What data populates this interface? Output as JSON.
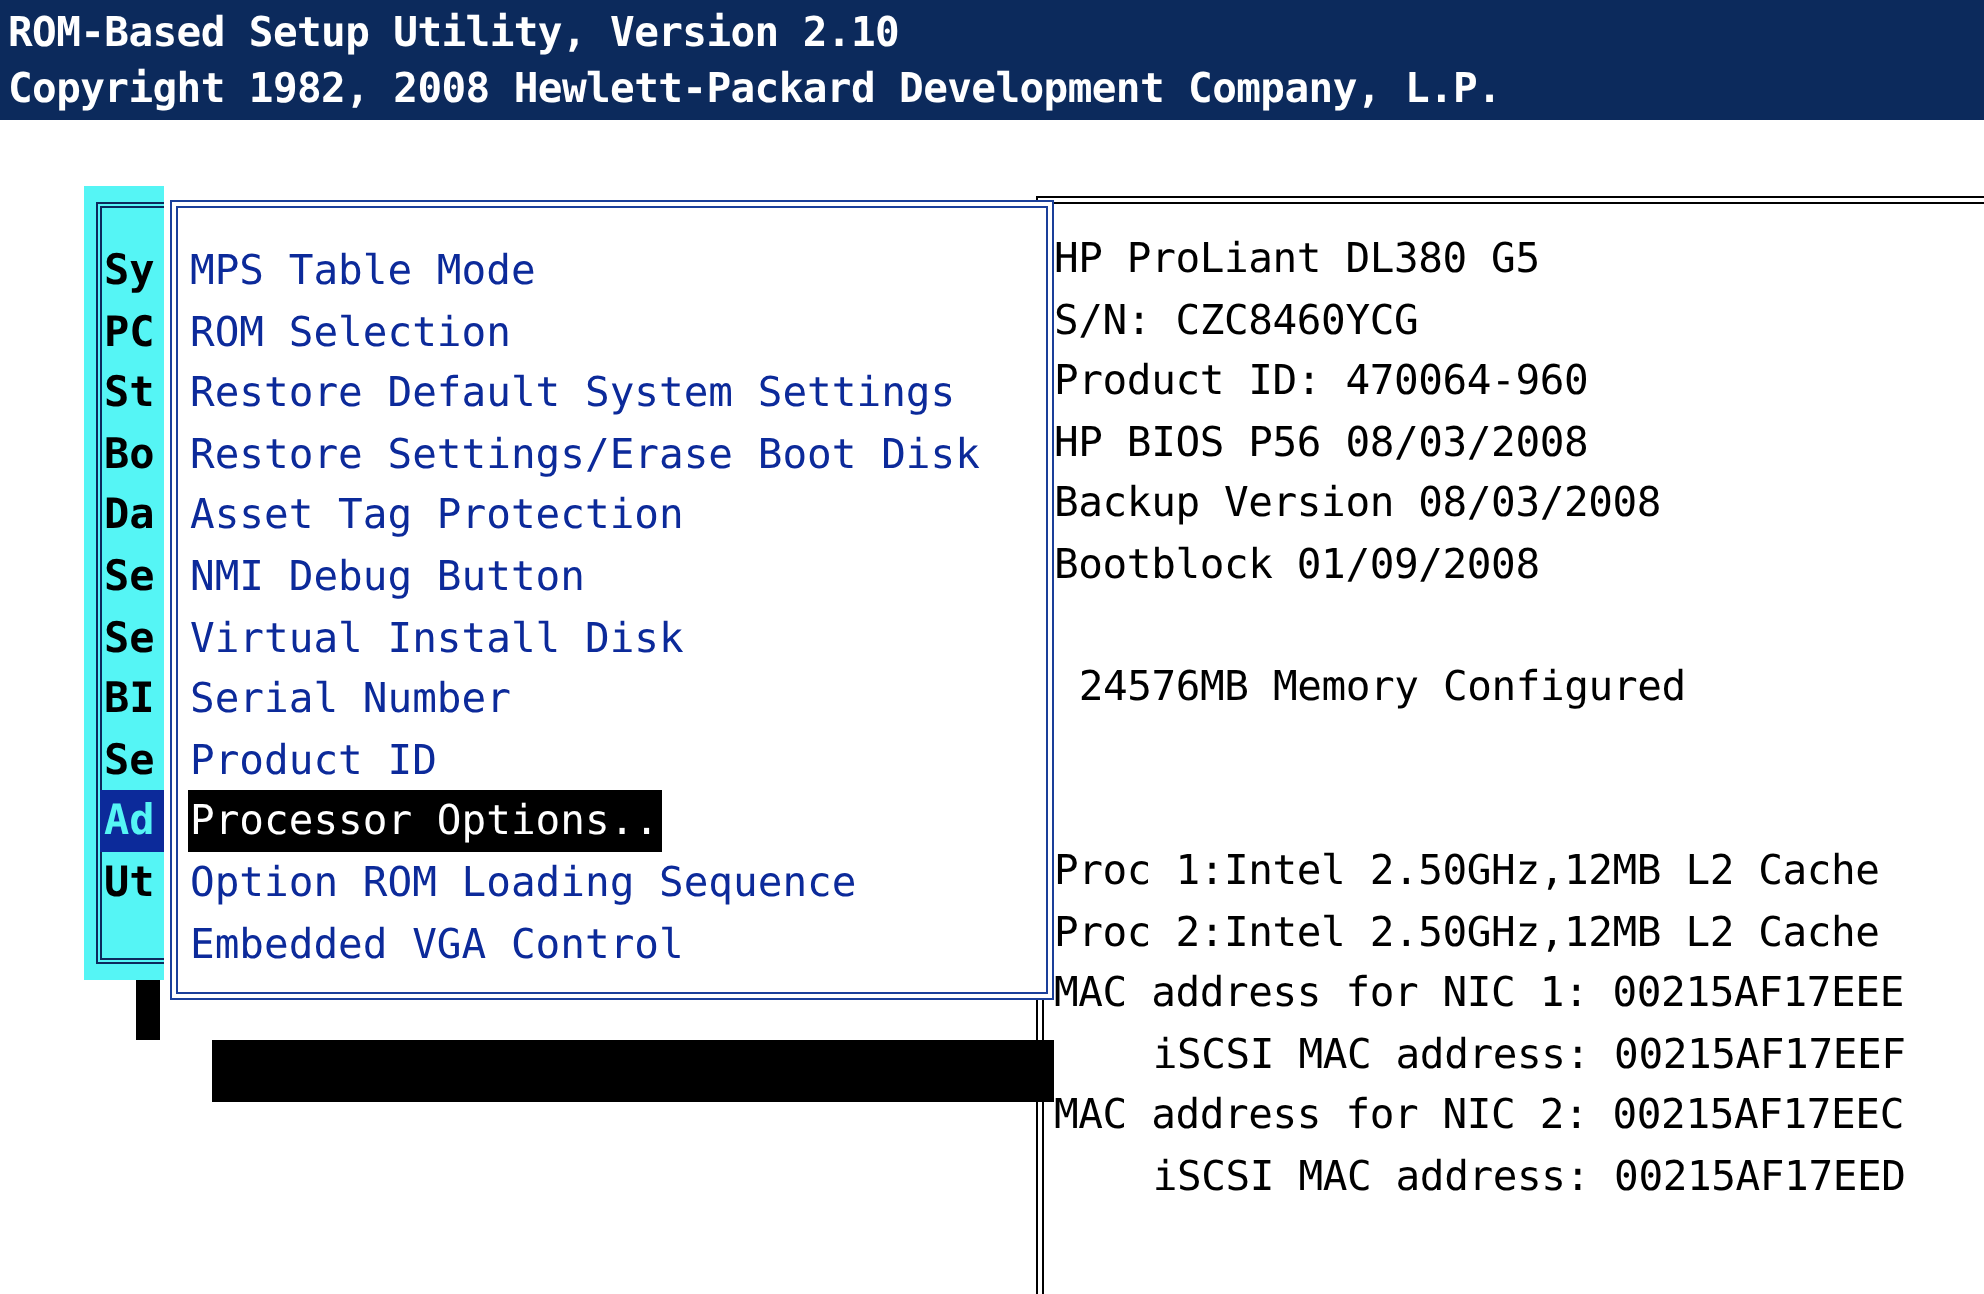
{
  "header": {
    "title": "ROM-Based Setup Utility, Version 2.10",
    "copyright": "Copyright 1982, 2008 Hewlett-Packard Development Company, L.P."
  },
  "main_menu": {
    "items": [
      {
        "label": "Sy",
        "selected": false
      },
      {
        "label": "PC",
        "selected": false
      },
      {
        "label": "St",
        "selected": false
      },
      {
        "label": "Bo",
        "selected": false
      },
      {
        "label": "Da",
        "selected": false
      },
      {
        "label": "Se",
        "selected": false
      },
      {
        "label": "Se",
        "selected": false
      },
      {
        "label": "BI",
        "selected": false
      },
      {
        "label": "Se",
        "selected": false
      },
      {
        "label": "Ad",
        "selected": true
      },
      {
        "label": "Ut",
        "selected": false
      }
    ]
  },
  "submenu": {
    "items": [
      {
        "label": "MPS Table Mode",
        "selected": false
      },
      {
        "label": "ROM Selection",
        "selected": false
      },
      {
        "label": "Restore Default System Settings",
        "selected": false
      },
      {
        "label": "Restore Settings/Erase Boot Disk",
        "selected": false
      },
      {
        "label": "Asset Tag Protection",
        "selected": false
      },
      {
        "label": "NMI Debug Button",
        "selected": false
      },
      {
        "label": "Virtual Install Disk",
        "selected": false
      },
      {
        "label": "Serial Number",
        "selected": false
      },
      {
        "label": "Product ID",
        "selected": false
      },
      {
        "label": "Processor Options..",
        "selected": true
      },
      {
        "label": "Option ROM Loading Sequence",
        "selected": false
      },
      {
        "label": "Embedded VGA Control",
        "selected": false
      }
    ]
  },
  "system_info": {
    "sections": [
      {
        "lines": [
          {
            "text": "HP ProLiant DL380 G5",
            "kind": "line"
          },
          {
            "text": "S/N: CZC8460YCG",
            "kind": "line"
          },
          {
            "text": "Product ID: 470064-960",
            "kind": "line"
          },
          {
            "text": "HP BIOS P56 08/03/2008",
            "kind": "line"
          },
          {
            "text": "Backup Version 08/03/2008",
            "kind": "line"
          },
          {
            "text": "Bootblock 01/09/2008",
            "kind": "line"
          }
        ]
      },
      {
        "lines": [
          {
            "text": "24576MB Memory Configured",
            "kind": "lead"
          }
        ]
      },
      {
        "lines": [
          {
            "text": "Proc 1:Intel 2.50GHz,12MB L2 Cache",
            "kind": "line"
          },
          {
            "text": "Proc 2:Intel 2.50GHz,12MB L2 Cache",
            "kind": "line"
          },
          {
            "text": "MAC address for NIC 1: 00215AF17EEE",
            "kind": "line"
          },
          {
            "text": "iSCSI MAC address: 00215AF17EEF",
            "kind": "sub"
          },
          {
            "text": "MAC address for NIC 2: 00215AF17EEC",
            "kind": "line"
          },
          {
            "text": "iSCSI MAC address: 00215AF17EED",
            "kind": "sub"
          }
        ]
      }
    ]
  }
}
